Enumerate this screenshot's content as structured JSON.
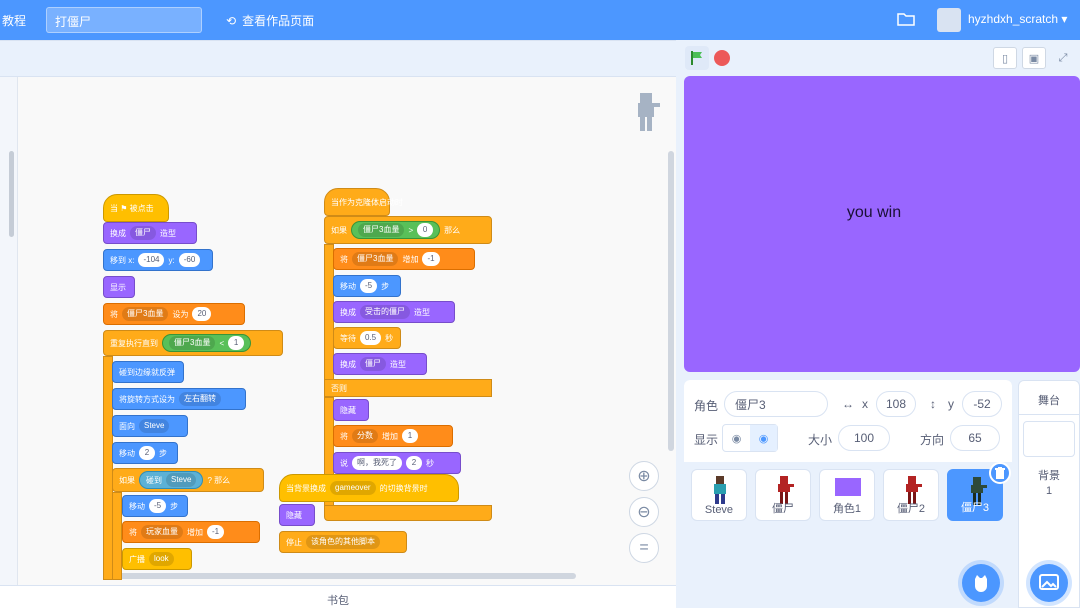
{
  "menubar": {
    "tutorials": "教程",
    "project_title": "打僵尸",
    "see_project_page": "查看作品页面",
    "username": "hyzhdxh_scratch"
  },
  "code": {
    "script1": {
      "hat": "当 ⚑ 被点击",
      "b1": {
        "verb": "换成",
        "costume": "僵尸",
        "tail": "造型"
      },
      "b2": {
        "verb": "移到 x:",
        "x": "-104",
        "ylab": "y:",
        "y": "-60"
      },
      "b3": "显示",
      "b4": {
        "verb": "将",
        "var": "僵尸3血量",
        "mid": "设为",
        "val": "20"
      },
      "b5": {
        "verb": "重复执行直到",
        "var": "僵尸3血量",
        "op": "<",
        "val": "1"
      },
      "b6": "碰到边缘就反弹",
      "b7": {
        "verb": "将旋转方式设为",
        "opt": "左右翻转"
      },
      "b8": {
        "verb": "面向",
        "target": "Steve"
      },
      "b9": {
        "verb": "移动",
        "val": "2",
        "tail": "步"
      },
      "b10": {
        "verb": "如果",
        "cond": "碰到",
        "target": "Steve",
        "tail": "? 那么"
      },
      "b11": {
        "verb": "移动",
        "val": "-5",
        "tail": "步"
      },
      "b12": {
        "verb": "将",
        "var": "玩家血量",
        "mid": "增加",
        "val": "-1"
      },
      "b13": {
        "verb": "广播",
        "msg": "look"
      }
    },
    "script2": {
      "hat": "当作为克隆体启动时",
      "b1": {
        "verb": "如果",
        "var": "僵尸3血量",
        "op": ">",
        "val": "0",
        "tail": "那么"
      },
      "b2": {
        "verb": "将",
        "var": "僵尸3血量",
        "mid": "增加",
        "val": "-1"
      },
      "b3": {
        "verb": "移动",
        "val": "-5",
        "tail": "步"
      },
      "b4": {
        "verb": "换成",
        "costume": "受击的僵尸",
        "tail": "造型"
      },
      "b5": {
        "verb": "等待",
        "val": "0.5",
        "tail": "秒"
      },
      "b6": {
        "verb": "换成",
        "costume": "僵尸",
        "tail": "造型"
      },
      "b7": "否则",
      "b8": "隐藏",
      "b9": {
        "verb": "将",
        "var": "分数",
        "mid": "增加",
        "val": "1"
      },
      "b10": {
        "verb": "说",
        "msg": "啊，我死了",
        "val": "2",
        "tail": "秒"
      }
    },
    "script3": {
      "hat": {
        "verb": "当背景换成",
        "bg": "gameover",
        "tail": "的切换背景时"
      },
      "b1": "隐藏",
      "b2": {
        "verb": "停止",
        "opt": "该角色的其他脚本"
      }
    },
    "backpack": "书包"
  },
  "stage": {
    "text": "you win"
  },
  "sprite_info": {
    "sprite_label": "角色",
    "sprite_name": "僵尸3",
    "x_label": "x",
    "x_value": "108",
    "y_label": "y",
    "y_value": "-52",
    "show_label": "显示",
    "size_label": "大小",
    "size_value": "100",
    "direction_label": "方向",
    "direction_value": "65"
  },
  "sprites": [
    {
      "name": "Steve",
      "color": "#2e4a3a"
    },
    {
      "name": "僵尸",
      "color": "#b32323"
    },
    {
      "name": "角色1",
      "color": "#9966ff"
    },
    {
      "name": "僵尸2",
      "color": "#b32323"
    },
    {
      "name": "僵尸3",
      "color": "#2e4a3a"
    }
  ],
  "stage_pane": {
    "title": "舞台",
    "backdrops_label": "背景",
    "backdrops_count": "1"
  }
}
